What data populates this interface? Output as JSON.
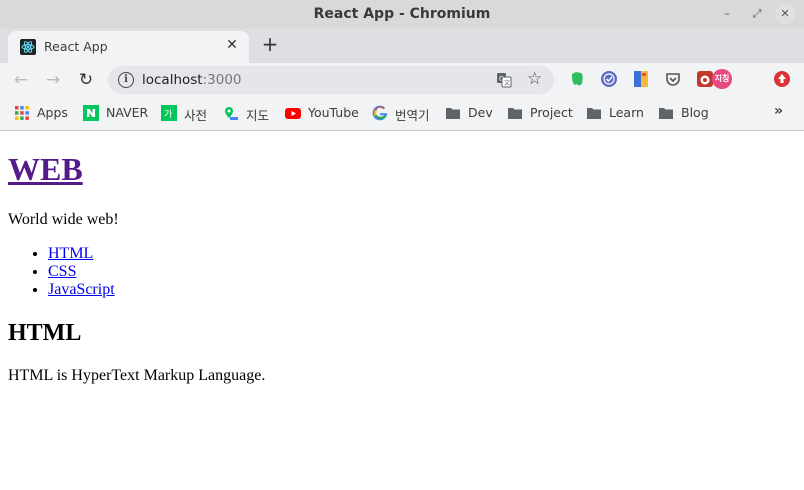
{
  "window": {
    "title": "React App - Chromium"
  },
  "tab": {
    "title": "React App"
  },
  "address": {
    "host": "localhost",
    "port": ":3000"
  },
  "bookmarks": [
    {
      "label": "Apps",
      "icon": "apps-grid-icon"
    },
    {
      "label": "NAVER",
      "icon": "naver-icon"
    },
    {
      "label": "사전",
      "icon": "dictionary-icon"
    },
    {
      "label": "지도",
      "icon": "map-icon"
    },
    {
      "label": "YouTube",
      "icon": "youtube-icon"
    },
    {
      "label": "번역기",
      "icon": "google-icon"
    },
    {
      "label": "Dev",
      "icon": "folder-icon"
    },
    {
      "label": "Project",
      "icon": "folder-icon"
    },
    {
      "label": "Learn",
      "icon": "folder-icon"
    },
    {
      "label": "Blog",
      "icon": "folder-icon"
    }
  ],
  "extensions": {
    "profile_label": "지칭"
  },
  "page": {
    "heading": "WEB",
    "tagline": "World wide web!",
    "nav": [
      "HTML",
      "CSS",
      "JavaScript"
    ],
    "section_title": "HTML",
    "section_body": "HTML is HyperText Markup Language."
  },
  "colors": {
    "visited_link": "#551a8b",
    "link": "#0000ee"
  }
}
